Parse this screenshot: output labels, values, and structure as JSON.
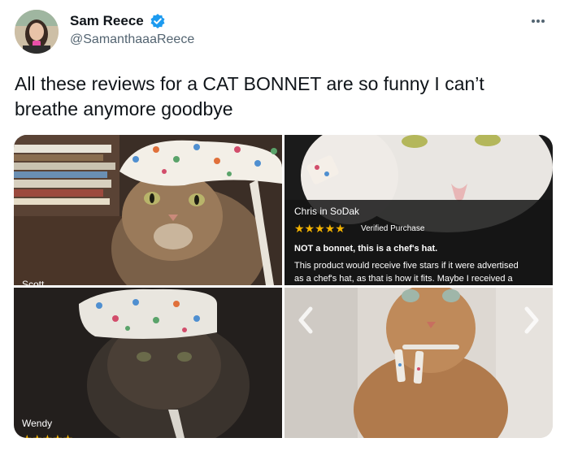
{
  "author": {
    "display_name": "Sam Reece",
    "handle": "@SamanthaaaReece",
    "verified_icon": "verified-badge-icon",
    "more_icon": "more-options-icon"
  },
  "tweet": {
    "text": "All these reviews for a CAT BONNET are so funny I can’t breathe anymore goodbye"
  },
  "media": {
    "images": [
      {
        "caption_name": "Scott",
        "subject": "tabby cat in floral bonnet by bookshelf"
      },
      {
        "caption_name": "Chris in SoDak",
        "stars": "★★★★★",
        "verified_purchase": "Verified Purchase",
        "review_title": "NOT a bonnet, this is a chef's hat.",
        "review_line1": "This product would receive five stars if it were advertised",
        "review_line2": "as a chef's hat, as that is how it fits. Maybe I received a"
      },
      {
        "caption_name": "Wendy",
        "stars": "★★★★★"
      },
      {
        "caption_name": "",
        "prev_icon": "chevron-left-icon",
        "next_icon": "chevron-right-icon"
      }
    ]
  },
  "colors": {
    "verified_blue": "#1d9bf0",
    "text_primary": "#0f1419",
    "text_secondary": "#536471",
    "star_gold": "#f5b400"
  }
}
